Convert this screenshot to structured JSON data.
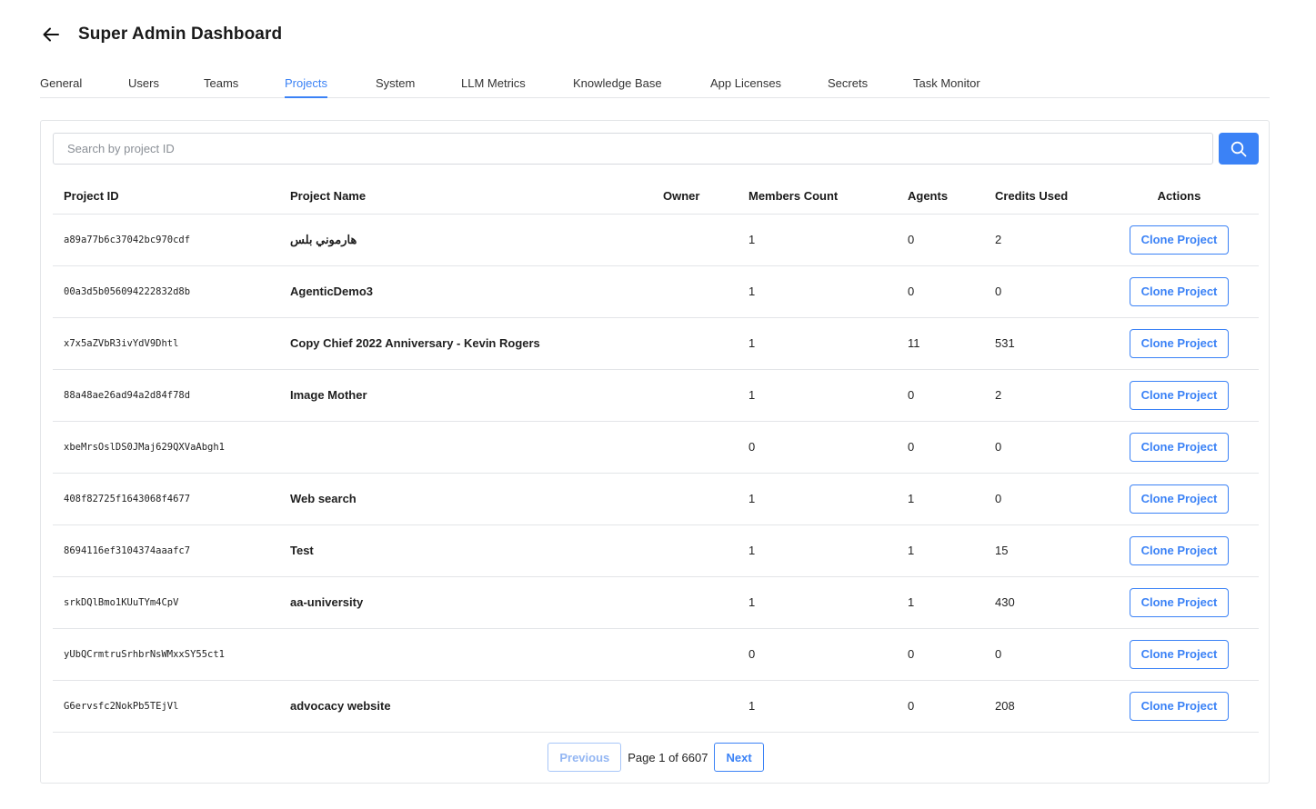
{
  "header": {
    "title": "Super Admin Dashboard"
  },
  "tabs": [
    {
      "label": "General"
    },
    {
      "label": "Users"
    },
    {
      "label": "Teams"
    },
    {
      "label": "Projects",
      "active": true
    },
    {
      "label": "System"
    },
    {
      "label": "LLM Metrics"
    },
    {
      "label": "Knowledge Base"
    },
    {
      "label": "App Licenses"
    },
    {
      "label": "Secrets"
    },
    {
      "label": "Task Monitor"
    }
  ],
  "search": {
    "placeholder": "Search by project ID",
    "value": ""
  },
  "table": {
    "columns": [
      "Project ID",
      "Project Name",
      "Owner",
      "Members Count",
      "Agents",
      "Credits Used",
      "Actions"
    ],
    "rows": [
      {
        "id": "a89a77b6c37042bc970cdf",
        "name": "هارموني بلس",
        "owner": "",
        "members": "1",
        "agents": "0",
        "credits": "2",
        "action": "Clone Project"
      },
      {
        "id": "00a3d5b056094222832d8b",
        "name": "AgenticDemo3",
        "owner": "",
        "members": "1",
        "agents": "0",
        "credits": "0",
        "action": "Clone Project"
      },
      {
        "id": "x7x5aZVbR3ivYdV9Dhtl",
        "name": "Copy Chief 2022 Anniversary - Kevin Rogers",
        "owner": "",
        "members": "1",
        "agents": "11",
        "credits": "531",
        "action": "Clone Project"
      },
      {
        "id": "88a48ae26ad94a2d84f78d",
        "name": "Image Mother",
        "owner": "",
        "members": "1",
        "agents": "0",
        "credits": "2",
        "action": "Clone Project"
      },
      {
        "id": "xbeMrsOslDS0JMaj629QXVaAbgh1",
        "name": "",
        "owner": "",
        "members": "0",
        "agents": "0",
        "credits": "0",
        "action": "Clone Project"
      },
      {
        "id": "408f82725f1643068f4677",
        "name": "Web search",
        "owner": "",
        "members": "1",
        "agents": "1",
        "credits": "0",
        "action": "Clone Project"
      },
      {
        "id": "8694116ef3104374aaafc7",
        "name": "Test",
        "owner": "",
        "members": "1",
        "agents": "1",
        "credits": "15",
        "action": "Clone Project"
      },
      {
        "id": "srkDQlBmo1KUuTYm4CpV",
        "name": "aa-university",
        "owner": "",
        "members": "1",
        "agents": "1",
        "credits": "430",
        "action": "Clone Project"
      },
      {
        "id": "yUbQCrmtruSrhbrNsWMxxSY55ct1",
        "name": "",
        "owner": "",
        "members": "0",
        "agents": "0",
        "credits": "0",
        "action": "Clone Project"
      },
      {
        "id": "G6ervsfc2NokPb5TEjVl",
        "name": "advocacy website",
        "owner": "",
        "members": "1",
        "agents": "0",
        "credits": "208",
        "action": "Clone Project"
      }
    ]
  },
  "pagination": {
    "previous": "Previous",
    "page_text": "Page 1 of 6607",
    "next": "Next"
  },
  "colors": {
    "accent": "#3b82f6"
  },
  "icons": {
    "back": "arrow-left-icon",
    "search": "search-icon"
  }
}
